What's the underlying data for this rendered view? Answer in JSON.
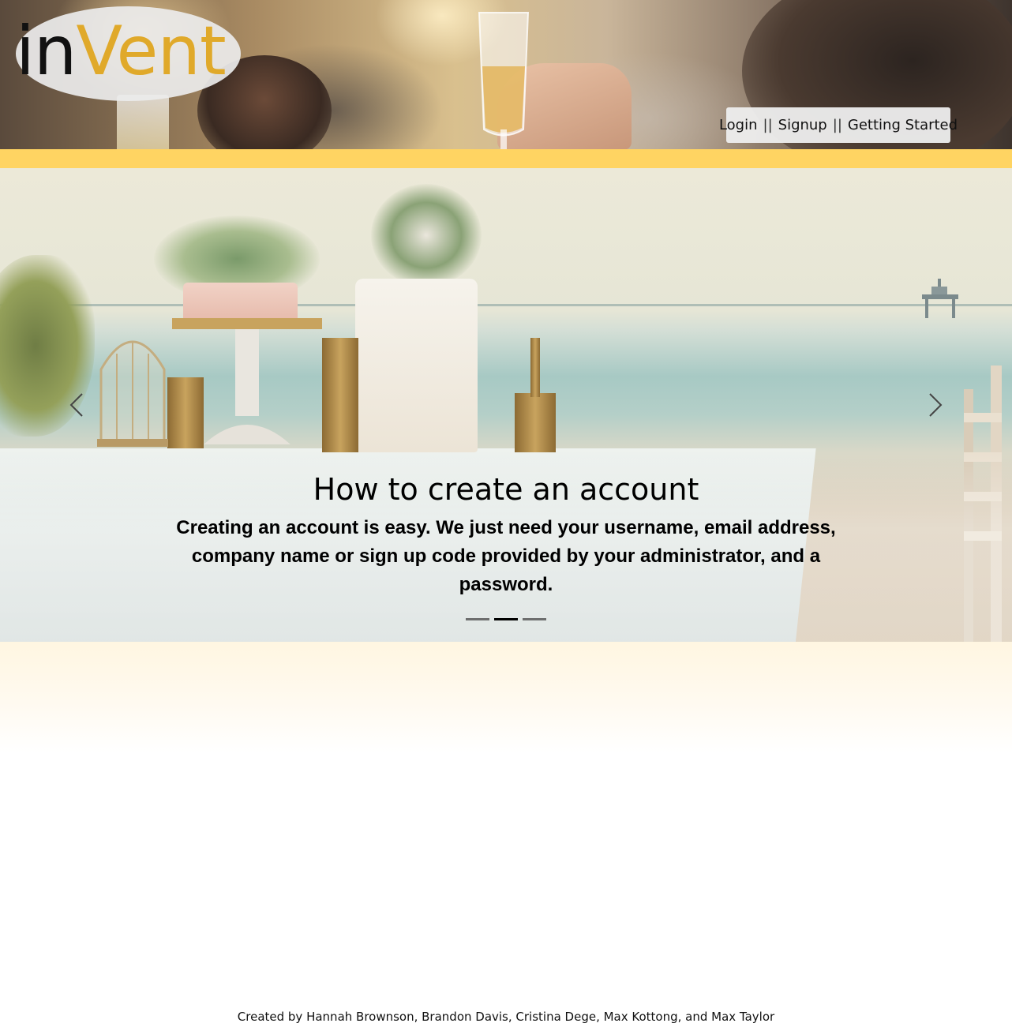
{
  "brand": {
    "logo_part_1": "in",
    "logo_part_2": "Vent",
    "color_dark": "#111111",
    "color_gold": "#e0a92a"
  },
  "nav": {
    "items": [
      {
        "label": "Login"
      },
      {
        "label": "Signup"
      },
      {
        "label": "Getting Started"
      }
    ],
    "separator": "||"
  },
  "carousel": {
    "active_index": 1,
    "slide_count": 3,
    "slide": {
      "title": "How to create an account",
      "text": "Creating an account is easy. We just need your username, email address, company name or sign up code provided by your administrator, and a password."
    },
    "prev_icon": "chevron-left-icon",
    "next_icon": "chevron-right-icon"
  },
  "footer": {
    "credits": "Created by Hannah Brownson, Brandon Davis, Cristina Dege, Max Kottong, and Max Taylor"
  },
  "colors": {
    "accent_band": "#ffd462",
    "lower_tint": "#fff6e1"
  }
}
